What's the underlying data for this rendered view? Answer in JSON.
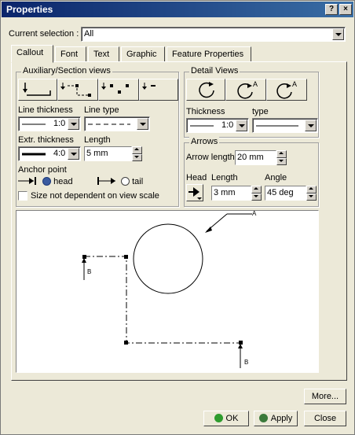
{
  "window": {
    "title": "Properties",
    "help_button": "?",
    "close_button": "×"
  },
  "selection": {
    "label": "Current selection :",
    "value": "All"
  },
  "tabs": [
    {
      "label": "Callout",
      "active": true
    },
    {
      "label": "Font"
    },
    {
      "label": "Text"
    },
    {
      "label": "Graphic"
    },
    {
      "label": "Feature Properties"
    }
  ],
  "aux_section": {
    "legend": "Auxiliary/Section views",
    "line_thickness_label": "Line thickness",
    "line_thickness_value": "1:0",
    "line_type_label": "Line type",
    "extr_thickness_label": "Extr. thickness",
    "extr_thickness_value": "4:0",
    "length_label": "Length",
    "length_value": "5 mm",
    "anchor_label": "Anchor point",
    "anchor_head": "head",
    "anchor_tail": "tail",
    "anchor_selected": "head",
    "size_checkbox_label": "Size not dependent on view scale",
    "size_checkbox_checked": false
  },
  "detail_views": {
    "legend": "Detail Views",
    "thickness_label": "Thickness",
    "thickness_value": "1:0",
    "type_label": "type"
  },
  "arrows": {
    "legend": "Arrows",
    "arrow_length_label": "Arrow length:",
    "arrow_length_value": "20 mm",
    "head_label": "Head",
    "length_label": "Length",
    "length_value": "3 mm",
    "angle_label": "Angle",
    "angle_value": "45 deg"
  },
  "preview": {
    "label_a": "A",
    "label_b1": "B",
    "label_b2": "B"
  },
  "buttons": {
    "more": "More...",
    "ok": "OK",
    "apply": "Apply",
    "close": "Close"
  },
  "colors": {
    "title_start": "#0a246a",
    "title_end": "#3a6ea5",
    "ok_dot": "#2e9c2e",
    "apply_dot": "#3b7a3b"
  }
}
